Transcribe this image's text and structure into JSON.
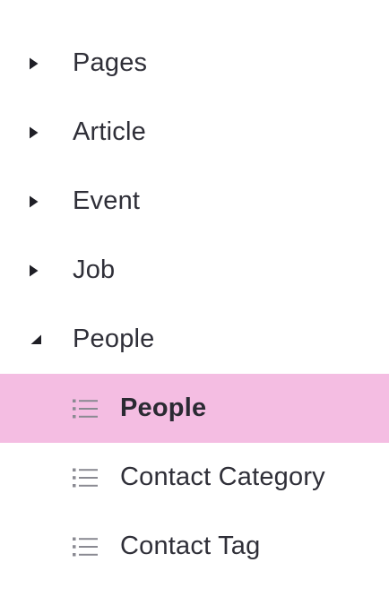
{
  "tree": {
    "groups": [
      {
        "label": "Pages",
        "expanded": false
      },
      {
        "label": "Article",
        "expanded": false
      },
      {
        "label": "Event",
        "expanded": false
      },
      {
        "label": "Job",
        "expanded": false
      },
      {
        "label": "People",
        "expanded": true
      }
    ],
    "children": [
      {
        "label": "People",
        "selected": true,
        "icon": "list-icon"
      },
      {
        "label": "Contact Category",
        "selected": false,
        "icon": "list-icon"
      },
      {
        "label": "Contact Tag",
        "selected": false,
        "icon": "list-icon"
      }
    ]
  },
  "colors": {
    "selected_background": "#f4bde2",
    "text": "#2f2f38",
    "icon": "#8a8a92"
  }
}
